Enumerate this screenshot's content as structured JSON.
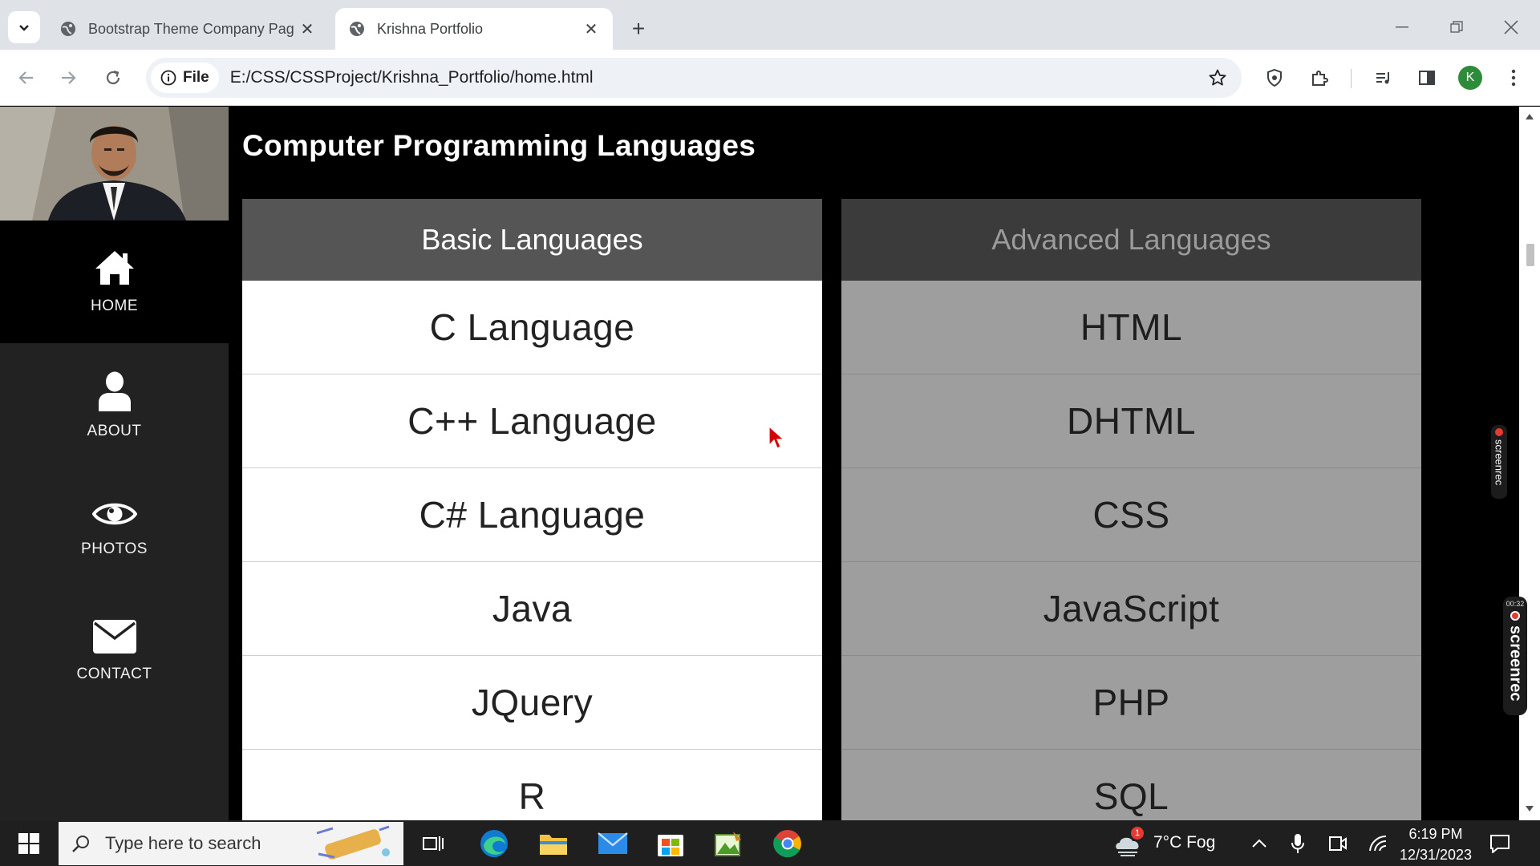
{
  "browser": {
    "tabs": [
      {
        "title": "Bootstrap Theme Company Pag",
        "active": false
      },
      {
        "title": "Krishna Portfolio",
        "active": true
      }
    ],
    "new_tab": "+",
    "chip_label": "File",
    "url": "E:/CSS/CSSProject/Krishna_Portfolio/home.html",
    "profile_initial": "K"
  },
  "sidebar": {
    "items": [
      {
        "label": "HOME",
        "icon": "home-icon",
        "active": true
      },
      {
        "label": "ABOUT",
        "icon": "user-icon",
        "active": false
      },
      {
        "label": "PHOTOS",
        "icon": "eye-icon",
        "active": false
      },
      {
        "label": "CONTACT",
        "icon": "envelope-icon",
        "active": false
      }
    ]
  },
  "main": {
    "heading": "Computer Programming Languages",
    "basic": {
      "title": "Basic Languages",
      "items": [
        "C Language",
        "C++ Language",
        "C# Language",
        "Java",
        "JQuery",
        "R"
      ]
    },
    "advanced": {
      "title": "Advanced Languages",
      "items": [
        "HTML",
        "DHTML",
        "CSS",
        "JavaScript",
        "PHP",
        "SQL"
      ]
    }
  },
  "overlays": {
    "screenrec_small": "screenrec",
    "screenrec_large": "screenrec",
    "screenrec_time": "00:32"
  },
  "taskbar": {
    "search_placeholder": "Type here to search",
    "weather": "7°C  Fog",
    "weather_badge": "1",
    "time": "6:19 PM",
    "date": "12/31/2023"
  },
  "colors": {
    "sidebar_bg": "#222222",
    "basic_header": "#555555",
    "advanced_header": "#3b3b3b",
    "advanced_cells": "#9e9e9e"
  }
}
